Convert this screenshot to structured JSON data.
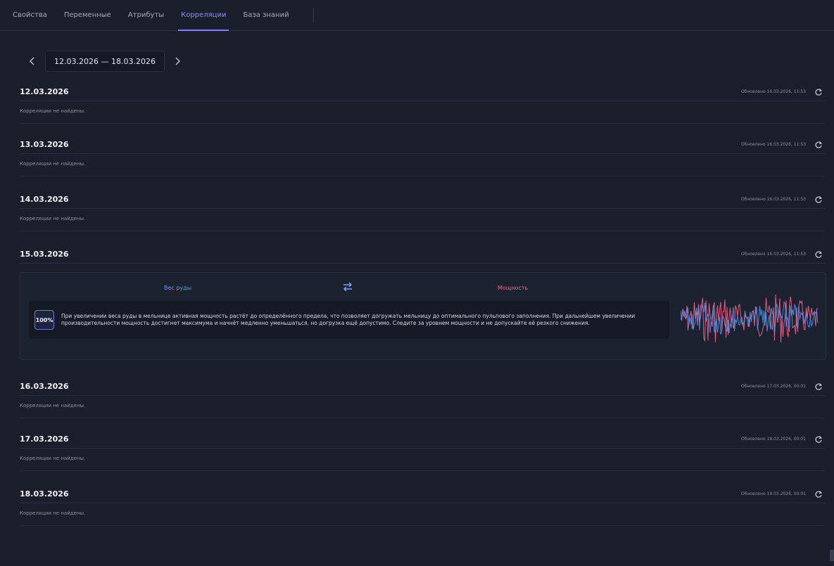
{
  "tabs": [
    {
      "label": "Свойства",
      "active": false
    },
    {
      "label": "Переменные",
      "active": false
    },
    {
      "label": "Атрибуты",
      "active": false
    },
    {
      "label": "Корреляции",
      "active": true
    },
    {
      "label": "База знаний",
      "active": false
    }
  ],
  "date_range": {
    "label": "12.03.2026 — 18.03.2026",
    "prev_icon": "chevron-left-icon",
    "next_icon": "chevron-right-icon"
  },
  "days": [
    {
      "date": "12.03.2026",
      "updated": "Обновлено 16.03.2026, 11:53",
      "empty_text": "Корреляции не найдены."
    },
    {
      "date": "13.03.2026",
      "updated": "Обновлено 16.03.2026, 11:53",
      "empty_text": "Корреляции не найдены."
    },
    {
      "date": "14.03.2026",
      "updated": "Обновлено 16.03.2026, 11:53",
      "empty_text": "Корреляции не найдены."
    },
    {
      "date": "15.03.2026",
      "updated": "Обновлено 16.03.2026, 11:53",
      "empty_text": ""
    },
    {
      "date": "16.03.2026",
      "updated": "Обновлено 17.03.2026, 00:01",
      "empty_text": "Корреляции не найдены."
    },
    {
      "date": "17.03.2026",
      "updated": "Обновлено 18.03.2026, 00:01",
      "empty_text": "Корреляции не найдены."
    },
    {
      "date": "18.03.2026",
      "updated": "Обновлено 19.03.2026, 00:01",
      "empty_text": "Корреляции не найдены."
    }
  ],
  "correlation": {
    "variable_left": "Вес руды",
    "variable_right": "Мощность",
    "confidence": "100%",
    "description": "При увеличении веса руды в мельнице активная мощность растёт до определённого предела, что позволяет догружать мельницу до оптимального пульпового заполнения. При дальнейшем увеличении производительности мощность достигнет максимума и начнёт медленно уменьшаться, но догрузка ещё допустимо. Следите за уровнем мощности и не допускайте её резкого снижения.",
    "left_color": "#4e9cff",
    "right_color": "#ff5f87"
  },
  "icons": {
    "refresh": "refresh-icon",
    "swap": "swap-arrows-icon"
  }
}
